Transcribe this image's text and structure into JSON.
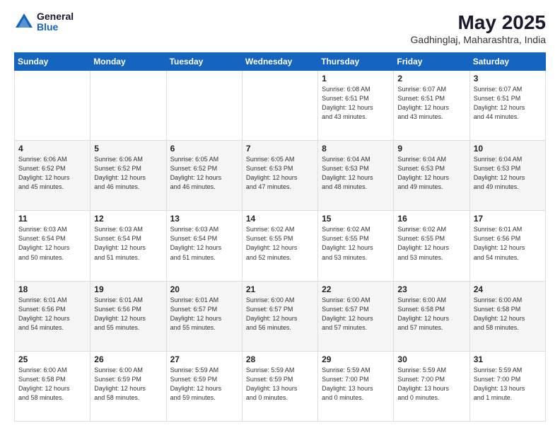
{
  "header": {
    "logo_general": "General",
    "logo_blue": "Blue",
    "month_title": "May 2025",
    "location": "Gadhinglaj, Maharashtra, India"
  },
  "days_of_week": [
    "Sunday",
    "Monday",
    "Tuesday",
    "Wednesday",
    "Thursday",
    "Friday",
    "Saturday"
  ],
  "weeks": [
    [
      {
        "day": "",
        "info": ""
      },
      {
        "day": "",
        "info": ""
      },
      {
        "day": "",
        "info": ""
      },
      {
        "day": "",
        "info": ""
      },
      {
        "day": "1",
        "info": "Sunrise: 6:08 AM\nSunset: 6:51 PM\nDaylight: 12 hours\nand 43 minutes."
      },
      {
        "day": "2",
        "info": "Sunrise: 6:07 AM\nSunset: 6:51 PM\nDaylight: 12 hours\nand 43 minutes."
      },
      {
        "day": "3",
        "info": "Sunrise: 6:07 AM\nSunset: 6:51 PM\nDaylight: 12 hours\nand 44 minutes."
      }
    ],
    [
      {
        "day": "4",
        "info": "Sunrise: 6:06 AM\nSunset: 6:52 PM\nDaylight: 12 hours\nand 45 minutes."
      },
      {
        "day": "5",
        "info": "Sunrise: 6:06 AM\nSunset: 6:52 PM\nDaylight: 12 hours\nand 46 minutes."
      },
      {
        "day": "6",
        "info": "Sunrise: 6:05 AM\nSunset: 6:52 PM\nDaylight: 12 hours\nand 46 minutes."
      },
      {
        "day": "7",
        "info": "Sunrise: 6:05 AM\nSunset: 6:53 PM\nDaylight: 12 hours\nand 47 minutes."
      },
      {
        "day": "8",
        "info": "Sunrise: 6:04 AM\nSunset: 6:53 PM\nDaylight: 12 hours\nand 48 minutes."
      },
      {
        "day": "9",
        "info": "Sunrise: 6:04 AM\nSunset: 6:53 PM\nDaylight: 12 hours\nand 49 minutes."
      },
      {
        "day": "10",
        "info": "Sunrise: 6:04 AM\nSunset: 6:53 PM\nDaylight: 12 hours\nand 49 minutes."
      }
    ],
    [
      {
        "day": "11",
        "info": "Sunrise: 6:03 AM\nSunset: 6:54 PM\nDaylight: 12 hours\nand 50 minutes."
      },
      {
        "day": "12",
        "info": "Sunrise: 6:03 AM\nSunset: 6:54 PM\nDaylight: 12 hours\nand 51 minutes."
      },
      {
        "day": "13",
        "info": "Sunrise: 6:03 AM\nSunset: 6:54 PM\nDaylight: 12 hours\nand 51 minutes."
      },
      {
        "day": "14",
        "info": "Sunrise: 6:02 AM\nSunset: 6:55 PM\nDaylight: 12 hours\nand 52 minutes."
      },
      {
        "day": "15",
        "info": "Sunrise: 6:02 AM\nSunset: 6:55 PM\nDaylight: 12 hours\nand 53 minutes."
      },
      {
        "day": "16",
        "info": "Sunrise: 6:02 AM\nSunset: 6:55 PM\nDaylight: 12 hours\nand 53 minutes."
      },
      {
        "day": "17",
        "info": "Sunrise: 6:01 AM\nSunset: 6:56 PM\nDaylight: 12 hours\nand 54 minutes."
      }
    ],
    [
      {
        "day": "18",
        "info": "Sunrise: 6:01 AM\nSunset: 6:56 PM\nDaylight: 12 hours\nand 54 minutes."
      },
      {
        "day": "19",
        "info": "Sunrise: 6:01 AM\nSunset: 6:56 PM\nDaylight: 12 hours\nand 55 minutes."
      },
      {
        "day": "20",
        "info": "Sunrise: 6:01 AM\nSunset: 6:57 PM\nDaylight: 12 hours\nand 55 minutes."
      },
      {
        "day": "21",
        "info": "Sunrise: 6:00 AM\nSunset: 6:57 PM\nDaylight: 12 hours\nand 56 minutes."
      },
      {
        "day": "22",
        "info": "Sunrise: 6:00 AM\nSunset: 6:57 PM\nDaylight: 12 hours\nand 57 minutes."
      },
      {
        "day": "23",
        "info": "Sunrise: 6:00 AM\nSunset: 6:58 PM\nDaylight: 12 hours\nand 57 minutes."
      },
      {
        "day": "24",
        "info": "Sunrise: 6:00 AM\nSunset: 6:58 PM\nDaylight: 12 hours\nand 58 minutes."
      }
    ],
    [
      {
        "day": "25",
        "info": "Sunrise: 6:00 AM\nSunset: 6:58 PM\nDaylight: 12 hours\nand 58 minutes."
      },
      {
        "day": "26",
        "info": "Sunrise: 6:00 AM\nSunset: 6:59 PM\nDaylight: 12 hours\nand 58 minutes."
      },
      {
        "day": "27",
        "info": "Sunrise: 5:59 AM\nSunset: 6:59 PM\nDaylight: 12 hours\nand 59 minutes."
      },
      {
        "day": "28",
        "info": "Sunrise: 5:59 AM\nSunset: 6:59 PM\nDaylight: 13 hours\nand 0 minutes."
      },
      {
        "day": "29",
        "info": "Sunrise: 5:59 AM\nSunset: 7:00 PM\nDaylight: 13 hours\nand 0 minutes."
      },
      {
        "day": "30",
        "info": "Sunrise: 5:59 AM\nSunset: 7:00 PM\nDaylight: 13 hours\nand 0 minutes."
      },
      {
        "day": "31",
        "info": "Sunrise: 5:59 AM\nSunset: 7:00 PM\nDaylight: 13 hours\nand 1 minute."
      }
    ]
  ]
}
